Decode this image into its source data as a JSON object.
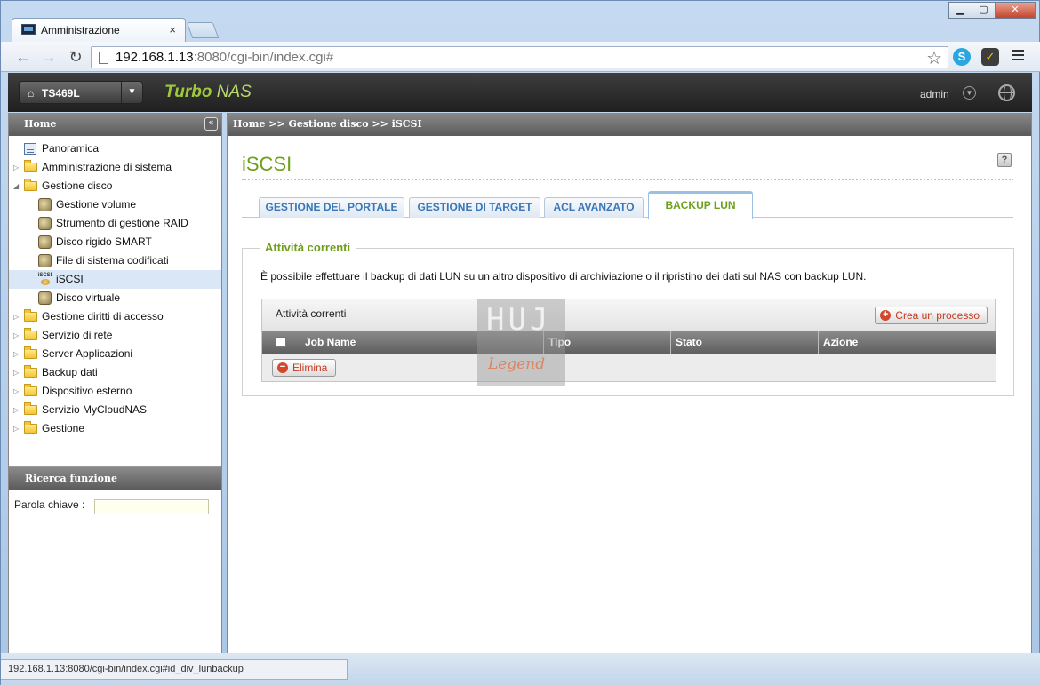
{
  "browser": {
    "tab_title": "Amministrazione",
    "tab_close": "×",
    "url_host": "192.168.1.13",
    "url_rest": ":8080/cgi-bin/index.cgi#",
    "status_url": "192.168.1.13:8080/cgi-bin/index.cgi#id_div_lunbackup",
    "window_buttons": {
      "minimize": "▁",
      "maximize": "▢",
      "close": "✕"
    },
    "nav": {
      "back": "←",
      "forward": "→",
      "reload": "↻",
      "star": "☆",
      "skype": "S",
      "tool": "✓"
    }
  },
  "header": {
    "device": "TS469L",
    "brand_turbo": "Turbo",
    "brand_nas": " NAS",
    "user": "admin",
    "dropdown_glyph": "▼",
    "home_glyph": "⌂",
    "user_dd_glyph": "▼"
  },
  "sidebar": {
    "title": "Home",
    "collapse": "«",
    "items": [
      {
        "label": "Panoramica"
      },
      {
        "label": "Amministrazione di sistema",
        "arrow": "▷"
      },
      {
        "label": "Gestione disco",
        "arrow": "◢"
      },
      {
        "label": "Gestione volume"
      },
      {
        "label": "Strumento di gestione RAID"
      },
      {
        "label": "Disco rigido SMART"
      },
      {
        "label": "File di sistema codificati"
      },
      {
        "label": "iSCSI",
        "icon_text": "iSCSI"
      },
      {
        "label": "Disco virtuale"
      },
      {
        "label": "Gestione diritti di accesso",
        "arrow": "▷"
      },
      {
        "label": "Servizio di rete",
        "arrow": "▷"
      },
      {
        "label": "Server Applicazioni",
        "arrow": "▷"
      },
      {
        "label": "Backup dati",
        "arrow": "▷"
      },
      {
        "label": "Dispositivo esterno",
        "arrow": "▷"
      },
      {
        "label": "Servizio MyCloudNAS",
        "arrow": "▷"
      },
      {
        "label": "Gestione",
        "arrow": "▷"
      }
    ],
    "search": {
      "title": "Ricerca funzione",
      "keyword_label": "Parola chiave :",
      "keyword_value": ""
    }
  },
  "content": {
    "breadcrumb": "Home >> Gestione disco >> iSCSI",
    "title": "iSCSI",
    "help": "?",
    "tabs": [
      {
        "label": "GESTIONE DEL PORTALE"
      },
      {
        "label": "GESTIONE DI TARGET"
      },
      {
        "label": "ACL AVANZATO"
      },
      {
        "label": "BACKUP LUN",
        "active": true
      }
    ],
    "section": {
      "legend": "Attività correnti",
      "description": "È possibile effettuare il backup di dati LUN su un altro dispositivo di archiviazione o il ripristino dei dati sul NAS con backup LUN.",
      "grid_title": "Attività correnti",
      "create_label": "Crea un processo",
      "columns": [
        "Job Name",
        "Tipo",
        "Stato",
        "Azione"
      ],
      "delete_label": "Elimina",
      "plus_glyph": "+",
      "minus_glyph": "−"
    }
  },
  "watermark": {
    "top": "HUJ",
    "bottom": "Legend"
  },
  "colors": {
    "accent_green": "#6d9f1a",
    "tab_blue": "#3a77b8",
    "action_red": "#c63a21"
  }
}
